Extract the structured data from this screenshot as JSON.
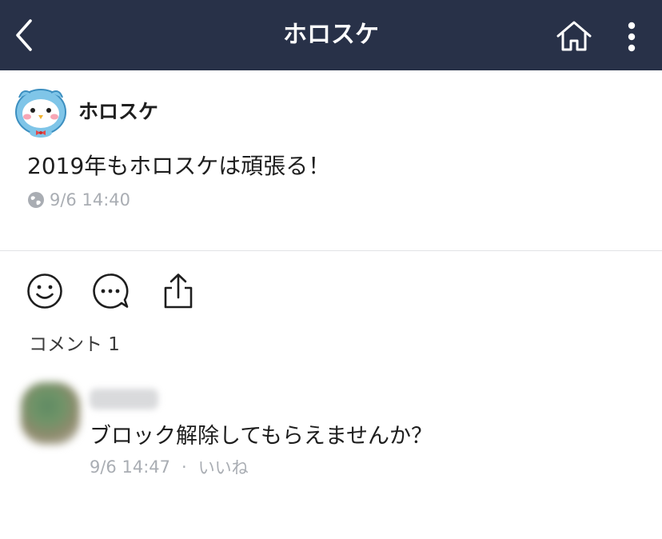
{
  "nav": {
    "title": "ホロスケ",
    "back_icon": "chevron-left-icon",
    "home_icon": "home-icon",
    "more_icon": "more-vertical-icon",
    "background": "#283148"
  },
  "post": {
    "author": "ホロスケ",
    "body": "2019年もホロスケは頑張る！",
    "timestamp": "9/6 14:40",
    "visibility_icon": "globe-icon"
  },
  "actions": {
    "react_icon": "smiley-icon",
    "comment_icon": "comment-bubble-icon",
    "share_icon": "share-icon"
  },
  "comments": {
    "count_label": "コメント 1",
    "items": [
      {
        "text": "ブロック解除してもらえませんか？",
        "timestamp": "9/6 14:47",
        "separator": "·",
        "like_label": "いいね"
      }
    ]
  }
}
